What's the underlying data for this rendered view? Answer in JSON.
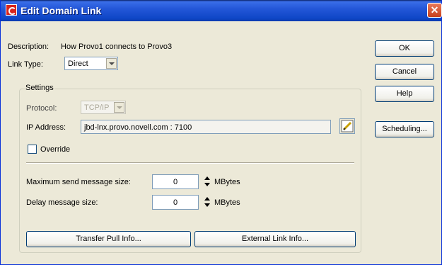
{
  "window": {
    "title": "Edit Domain Link",
    "close_glyph": "✕"
  },
  "form": {
    "description_label": "Description:",
    "description_value": "How Provo1 connects to Provo3",
    "link_type_label": "Link Type:",
    "link_type_value": "Direct"
  },
  "settings": {
    "group_title": "Settings",
    "protocol_label": "Protocol:",
    "protocol_value": "TCP/IP",
    "ip_label": "IP Address:",
    "ip_value": "jbd-lnx.provo.novell.com : 7100",
    "override_label": "Override",
    "override_checked": false,
    "max_send_label": "Maximum send message size:",
    "max_send_value": "0",
    "max_send_unit": "MBytes",
    "delay_label": "Delay message size:",
    "delay_value": "0",
    "delay_unit": "MBytes",
    "transfer_button": "Transfer Pull Info...",
    "external_button": "External Link Info..."
  },
  "side_buttons": {
    "ok": "OK",
    "cancel": "Cancel",
    "help": "Help",
    "scheduling": "Scheduling..."
  }
}
